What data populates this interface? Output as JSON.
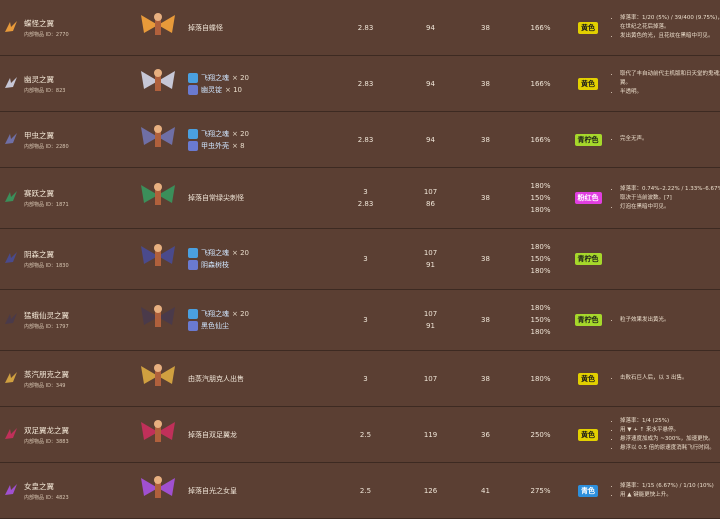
{
  "rows": [
    {
      "name": "蝶怪之翼",
      "id_label": "内部物品 ID：",
      "id": "2770",
      "source": "掉落自蝶怪",
      "v1": "2.83",
      "v2": "94",
      "v3": "38",
      "v4": "166%",
      "rarity": "黄色",
      "rarity_color": "#e2d000",
      "notes": [
        "掉落率：1/20 (5%) / 39/400 (9.75%)，仅在世纪之花后掉落。",
        "发出黄色的光，且花纹在黑暗中可见。"
      ]
    },
    {
      "name": "幽灵之翼",
      "id_label": "内部物品 ID：",
      "id": "823",
      "src_items": [
        {
          "label": "飞翔之魂",
          "qty": "× 20"
        },
        {
          "label": "幽灵锭",
          "qty": "× 10"
        }
      ],
      "v1": "2.83",
      "v2": "94",
      "v3": "38",
      "v4": "166%",
      "rarity": "黄色",
      "rarity_color": "#e2d000",
      "notes": [
        "取代了丰自动前代主机版和日天堂的鬼魂之翼。",
        "半透明。"
      ]
    },
    {
      "name": "甲虫之翼",
      "id_label": "内部物品 ID：",
      "id": "2280",
      "src_items": [
        {
          "label": "飞翔之魂",
          "qty": "× 20"
        },
        {
          "label": "甲虫外壳",
          "qty": "× 8"
        }
      ],
      "v1": "2.83",
      "v2": "94",
      "v3": "38",
      "v4": "166%",
      "rarity": "青柠色",
      "rarity_color": "#a6d82b",
      "notes": [
        "完全无声。"
      ]
    },
    {
      "name": "赛跃之翼",
      "id_label": "内部物品 ID：",
      "id": "1871",
      "source": "掉落自常绿尖刺怪",
      "v1a": "3",
      "v1b": "2.83",
      "v2a": "107",
      "v2b": "86",
      "v3": "38",
      "v4a": "180%",
      "v4b": "150%",
      "v4c": "180%",
      "rarity": "粉红色",
      "rarity_color": "#e13ee0",
      "notes": [
        "掉落率：0.74%–2.22% / 1.33%–6.67%，取决于当前波数。[7]",
        "灯泡在黑暗中可见。"
      ]
    },
    {
      "name": "阴森之翼",
      "id_label": "内部物品 ID：",
      "id": "1830",
      "src_items": [
        {
          "label": "飞翔之魂",
          "qty": "× 20"
        },
        {
          "label": "阴森树枝",
          "qty": ""
        }
      ],
      "v1": "3",
      "v2a": "107",
      "v2b": "91",
      "v3": "38",
      "v4a": "180%",
      "v4b": "150%",
      "v4c": "180%",
      "rarity": "青柠色",
      "rarity_color": "#a6d82b",
      "notes": []
    },
    {
      "name": "猛蛾仙灵之翼",
      "id_label": "内部物品 ID：",
      "id": "1797",
      "src_items": [
        {
          "label": "飞翔之魂",
          "qty": "× 20"
        },
        {
          "label": "黑色仙尘",
          "qty": ""
        }
      ],
      "v1": "3",
      "v2a": "107",
      "v2b": "91",
      "v3": "38",
      "v4a": "180%",
      "v4b": "150%",
      "v4c": "180%",
      "rarity": "青柠色",
      "rarity_color": "#a6d82b",
      "notes": [
        "粒子效果发出黄光。"
      ]
    },
    {
      "name": "蒸汽朋克之翼",
      "id_label": "内部物品 ID：",
      "id": "349",
      "source": "由蒸汽朋克人出售",
      "v1": "3",
      "v2": "107",
      "v3": "38",
      "v4": "180%",
      "rarity": "黄色",
      "rarity_color": "#e2d000",
      "notes": [
        "击败石巨人后，以 3 出售。"
      ]
    },
    {
      "name": "双足翼龙之翼",
      "id_label": "内部物品 ID：",
      "id": "3883",
      "source": "掉落自双足翼龙",
      "v1": "2.5",
      "v2": "119",
      "v3": "36",
      "v4": "250%",
      "rarity": "黄色",
      "rarity_color": "#e2d000",
      "notes": [
        "掉落率：1/4 (25%)",
        "用 ▼ + ↑ 来水平悬停。",
        "悬浮速度加成为 ~300%，加速更快。",
        "悬浮以 0.5 倍的原速度消耗飞行时间。"
      ]
    },
    {
      "name": "女皇之翼",
      "id_label": "内部物品 ID：",
      "id": "4823",
      "source": "掉落自光之女皇",
      "v1": "2.5",
      "v2": "126",
      "v3": "41",
      "v4": "275%",
      "rarity": "青色",
      "rarity_color": "#2d8fdc",
      "notes": [
        "掉落率：1/15 (6.67%) / 1/10 (10%)",
        "用 ▲ 键能更快上升。"
      ]
    }
  ]
}
